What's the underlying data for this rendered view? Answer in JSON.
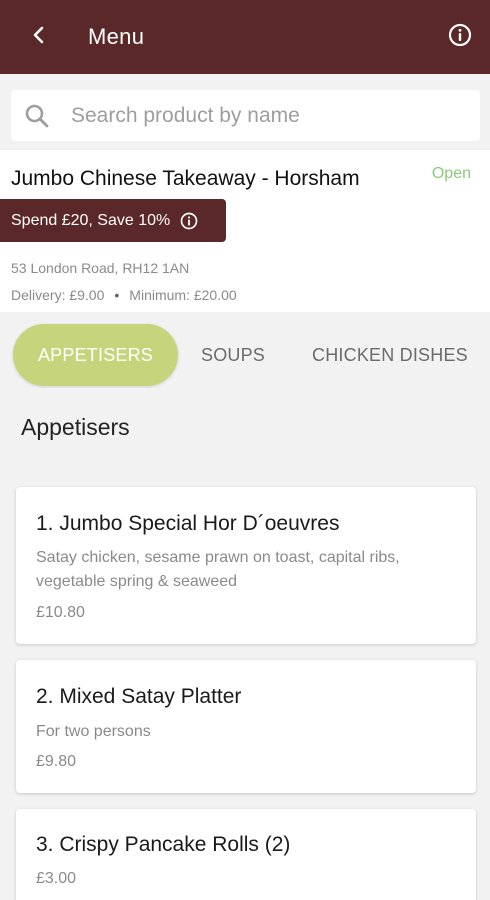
{
  "header": {
    "title": "Menu",
    "back_icon": "chevron-left-icon",
    "info_icon": "info-icon"
  },
  "search": {
    "placeholder": "Search product by name",
    "icon": "search-icon"
  },
  "store": {
    "name": "Jumbo Chinese Takeaway - Horsham",
    "status": "Open",
    "status_color": "#8bc97a",
    "offer": "Spend £20, Save 10%",
    "address": "53 London Road, RH12 1AN",
    "delivery": "Delivery: £9.00",
    "minimum": "Minimum: £20.00"
  },
  "tabs": [
    {
      "label": "APPETISERS",
      "active": true
    },
    {
      "label": "SOUPS",
      "active": false
    },
    {
      "label": "CHICKEN DISHES",
      "active": false
    }
  ],
  "section": {
    "title": "Appetisers"
  },
  "items": [
    {
      "title": "1. Jumbo Special Hor D´oeuvres",
      "description": "Satay chicken, sesame prawn on toast, capital ribs, vegetable spring & seaweed",
      "price": "£10.80"
    },
    {
      "title": "2. Mixed Satay Platter",
      "description": "For two persons",
      "price": "£9.80"
    },
    {
      "title": "3. Crispy Pancake Rolls (2)",
      "price": "£3.00"
    }
  ],
  "colors": {
    "brand": "#5a2828",
    "accent": "#c6d57c",
    "background": "#f2f2f2"
  }
}
